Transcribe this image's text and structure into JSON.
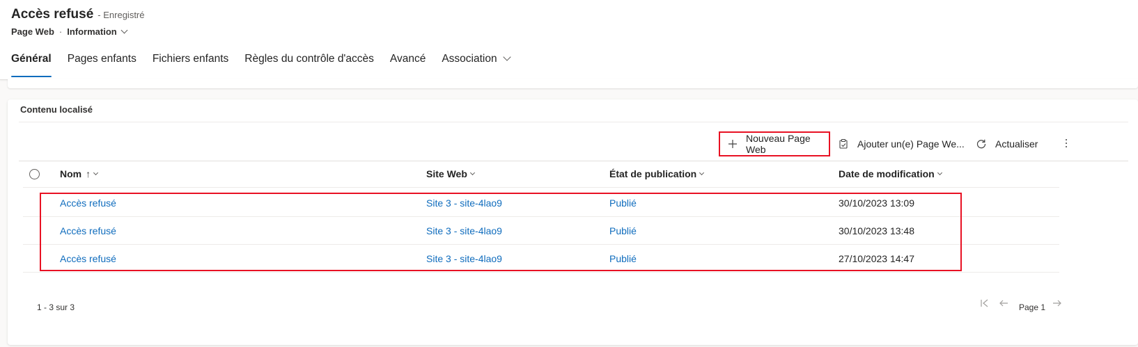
{
  "header": {
    "title": "Accès refusé",
    "status": "- Enregistré",
    "entity_type": "Page Web",
    "separator": "·",
    "form_name": "Information"
  },
  "tabs": [
    {
      "label": "Général",
      "active": true
    },
    {
      "label": "Pages enfants"
    },
    {
      "label": "Fichiers enfants"
    },
    {
      "label": "Règles du contrôle d'accès"
    },
    {
      "label": "Avancé"
    },
    {
      "label": "Association",
      "has_dropdown": true
    }
  ],
  "section": {
    "title": "Contenu localisé"
  },
  "commands": {
    "new_label": "Nouveau Page Web",
    "add_label": "Ajouter un(e) Page We...",
    "refresh_label": "Actualiser",
    "new_icon": "plus-icon",
    "add_icon": "add-existing-icon",
    "refresh_icon": "refresh-icon",
    "more_icon": "more-vertical-icon"
  },
  "grid": {
    "columns": [
      "Nom",
      "Site Web",
      "État de publication",
      "Date de modification"
    ],
    "sort_indicator": "↑",
    "rows": [
      {
        "name": "Accès refusé",
        "site": "Site 3 - site-4lao9",
        "status": "Publié",
        "modified": "30/10/2023 13:09"
      },
      {
        "name": "Accès refusé",
        "site": "Site 3 - site-4lao9",
        "status": "Publié",
        "modified": "30/10/2023 13:48"
      },
      {
        "name": "Accès refusé",
        "site": "Site 3 - site-4lao9",
        "status": "Publié",
        "modified": "27/10/2023 14:47"
      }
    ]
  },
  "footer": {
    "count": "1 - 3 sur 3",
    "page": "Page 1"
  },
  "colors": {
    "accent": "#0f6cbd",
    "highlight_border": "#e81123",
    "text": "#242424",
    "background": "#faf9f8"
  }
}
